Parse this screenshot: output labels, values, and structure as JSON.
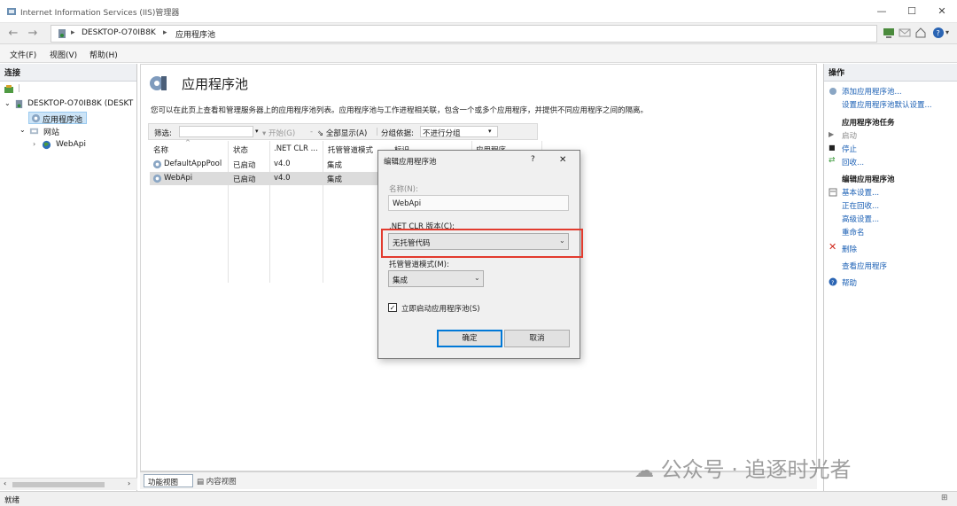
{
  "window": {
    "title": "Internet Information Services (IIS)管理器"
  },
  "address": {
    "segments": [
      "DESKTOP-O70IB8K",
      "应用程序池"
    ]
  },
  "menu": {
    "file": "文件(F)",
    "view": "视图(V)",
    "help": "帮助(H)"
  },
  "left": {
    "header": "连接",
    "tree": {
      "server": "DESKTOP-O70IB8K (DESKT",
      "app_pools": "应用程序池",
      "sites": "网站",
      "webapi": "WebApi"
    }
  },
  "main": {
    "title": "应用程序池",
    "description": "您可以在此页上查看和管理服务器上的应用程序池列表。应用程序池与工作进程相关联，包含一个或多个应用程序，并提供不同应用程序之间的隔离。",
    "filter": {
      "label": "筛选:",
      "go": "开始(G)",
      "show_all": "全部显示(A)",
      "group_by_label": "分组依据:",
      "group_by_value": "不进行分组"
    },
    "columns": [
      "名称",
      "状态",
      ".NET CLR ...",
      "托管管道模式",
      "标识",
      "应用程序"
    ],
    "rows": [
      {
        "name": "DefaultAppPool",
        "status": "已启动",
        "clr": "v4.0",
        "pipeline": "集成"
      },
      {
        "name": "WebApi",
        "status": "已启动",
        "clr": "v4.0",
        "pipeline": "集成"
      }
    ]
  },
  "right": {
    "header": "操作",
    "add_pool": "添加应用程序池...",
    "set_defaults": "设置应用程序池默认设置...",
    "tasks_title": "应用程序池任务",
    "start": "启动",
    "stop": "停止",
    "recycle": "回收...",
    "edit_title": "编辑应用程序池",
    "basic_settings": "基本设置...",
    "recycling": "正在回收...",
    "advanced_settings": "高级设置...",
    "rename": "重命名",
    "delete": "删除",
    "view_apps": "查看应用程序",
    "help": "帮助"
  },
  "tabs": {
    "features": "功能视图",
    "content": "内容视图"
  },
  "status": {
    "text": "就绪"
  },
  "dialog": {
    "title": "编辑应用程序池",
    "help_glyph": "?",
    "close_glyph": "✕",
    "name_label": "名称(N):",
    "name_value": "WebApi",
    "clr_label": ".NET CLR 版本(C):",
    "clr_value": "无托管代码",
    "pipeline_label": "托管管道模式(M):",
    "pipeline_value": "集成",
    "autostart_label": "立即启动应用程序池(S)",
    "autostart_checked": true,
    "ok": "确定",
    "cancel": "取消"
  },
  "watermark": {
    "text": "公众号 · 追逐时光者"
  },
  "colors": {
    "highlight": "#e23b2e",
    "selection": "#cce4f7",
    "link": "#1a5fb4"
  }
}
